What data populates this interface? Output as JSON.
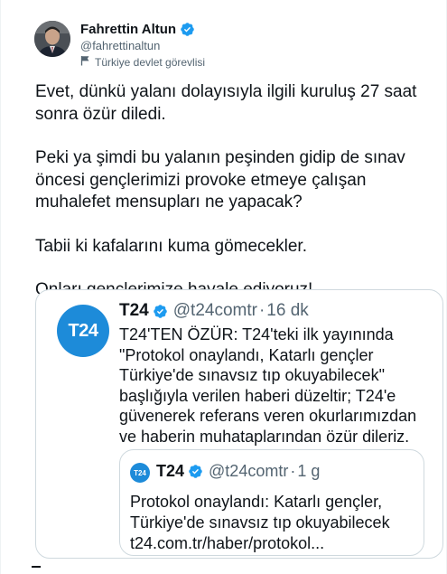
{
  "author": {
    "name": "Fahrettin Altun",
    "handle": "@fahrettinaltun",
    "label": "Türkiye devlet görevlisi",
    "label_icon": "flag-icon",
    "verified": true
  },
  "tweet": {
    "paragraphs": [
      "Evet, dünkü yalanı dolayısıyla ilgili kuruluş 27 saat sonra özür diledi.",
      "Peki ya şimdi bu yalanın peşinden gidip de sınav öncesi gençlerimizi provoke etmeye çalışan muhalefet mensupları ne yapacak?",
      "Tabii ki kafalarını kuma gömecekler.",
      "Onları gençlerimize havale ediyoruz!"
    ]
  },
  "quoted": {
    "avatar_text": "T24",
    "name": "T24",
    "handle": "@t24comtr",
    "separator": "·",
    "time": "16 dk",
    "text": "T24'TEN ÖZÜR: T24'teki ilk yayınında \"Protokol onaylandı, Katarlı gençler Türkiye'de sınavsız tıp okuyabilecek\" başlığıyla verilen haberi düzeltir; T24'e güvenerek referans veren okurlarımızdan ve haberin muhataplarından  özür dileriz.",
    "nested": {
      "avatar_text": "T24",
      "name": "T24",
      "handle": "@t24comtr",
      "separator": "·",
      "time": "1 g",
      "text_lines": [
        "Protokol onaylandı: Katarlı gençler,",
        "Türkiye'de sınavsız tıp okuyabilecek",
        "t24.com.tr/haber/protokol..."
      ]
    }
  },
  "colors": {
    "verified_blue": "#1d9bf0",
    "t24_blue": "#1d8bd9",
    "secondary_text": "#536471",
    "border": "#cfd9de"
  }
}
